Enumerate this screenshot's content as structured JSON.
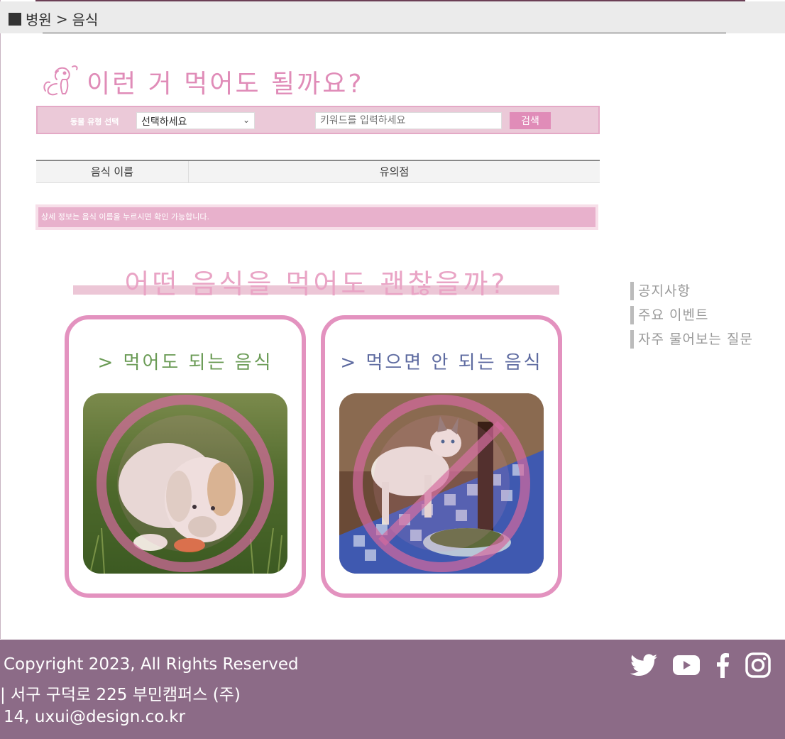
{
  "breadcrumb": {
    "home": "병원",
    "separator": ">",
    "current": "음식"
  },
  "page": {
    "title": "이런 거 먹어도 될까요?",
    "title_icon": "dog-icon"
  },
  "search": {
    "animal_type_label": "동물 유형 선택",
    "animal_type_value": "선택하세요",
    "keyword_placeholder": "키워드를 입력하세요",
    "search_button": "검색"
  },
  "table": {
    "columns": [
      "음식 이름",
      "유의점"
    ]
  },
  "notice": "상세 정보는 음식 이름을 누르시면 확인 가능합니다.",
  "section": {
    "title": "어떤 음식을 먹어도 괜찮을까?"
  },
  "cards": [
    {
      "title": "> 먹어도 되는 음식",
      "image": "puppy-eating-carrot-photo"
    },
    {
      "title": "> 먹으면 안 되는 음식",
      "image": "cat-on-table-photo"
    }
  ],
  "side_menu": [
    "공지사항",
    "주요 이벤트",
    "자주 물어보는 질문"
  ],
  "footer": {
    "copyright": "Copyright 2023, All Rights Reserved",
    "address": "| 서구 구덕로 225 부민캠퍼스 (주)",
    "contact": "14, uxui@design.co.kr",
    "social": [
      "twitter-icon",
      "youtube-icon",
      "facebook-icon",
      "instagram-icon"
    ]
  },
  "colors": {
    "accent_pink": "#e08cb8",
    "footer_bg": "#8c6b87",
    "ok_green": "#6a9b55",
    "no_blue": "#5d6aa0"
  }
}
